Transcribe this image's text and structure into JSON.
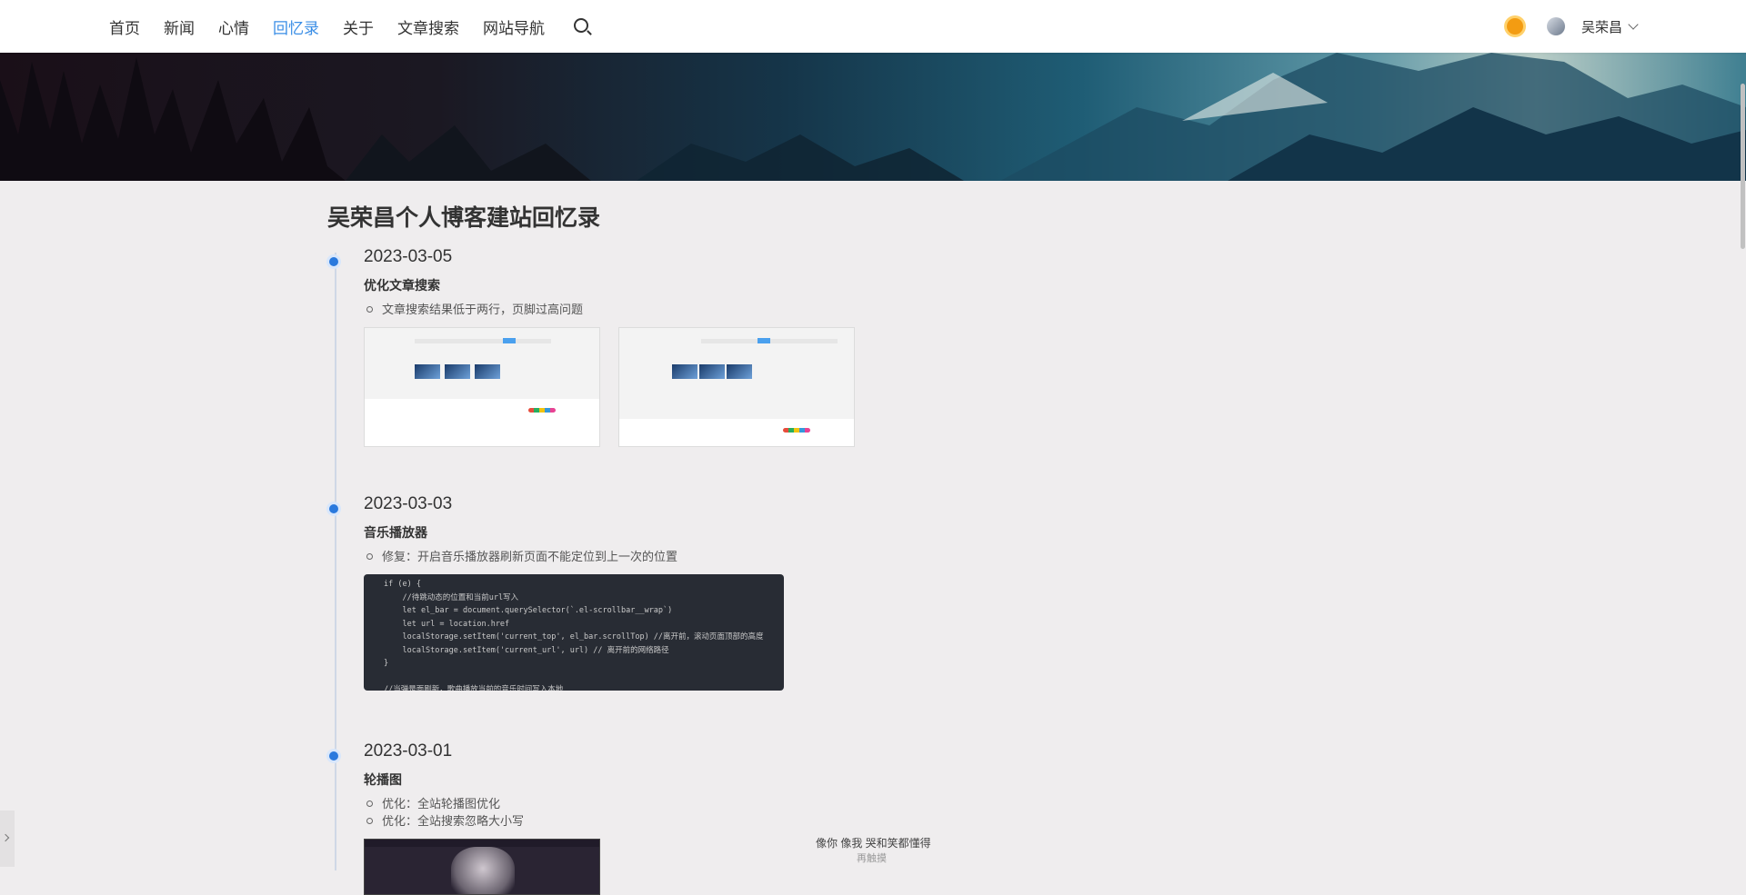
{
  "nav": {
    "items": [
      {
        "label": "首页"
      },
      {
        "label": "新闻"
      },
      {
        "label": "心情"
      },
      {
        "label": "回忆录"
      },
      {
        "label": "关于"
      },
      {
        "label": "文章搜索"
      },
      {
        "label": "网站导航"
      }
    ],
    "active": "回忆录",
    "user_name": "吴荣昌"
  },
  "page": {
    "title": "吴荣昌个人博客建站回忆录"
  },
  "timeline": [
    {
      "date": "2023-03-05",
      "title": "优化文章搜索",
      "items": [
        "文章搜索结果低于两行，页脚过高问题"
      ]
    },
    {
      "date": "2023-03-03",
      "title": "音乐播放器",
      "items": [
        "修复：开启音乐播放器刷新页面不能定位到上一次的位置"
      ]
    },
    {
      "date": "2023-03-01",
      "title": "轮播图",
      "items": [
        "优化：全站轮播图优化",
        "优化：全站搜索忽略大小写"
      ]
    }
  ],
  "code": {
    "lines": [
      "if (e) {",
      "    //待跳动态的位置和当前url写入",
      "    let el_bar = document.querySelector(`.el-scrollbar__wrap`)",
      "    let url = location.href",
      "    localStorage.setItem('current_top', el_bar.scrollTop) //离开前，滚动页面顶部的高度",
      "    localStorage.setItem('current_url', url) // 离开前的网络路径",
      "}",
      "",
      "//当弹是面刷新，歌曲播放当前的音乐时间写入本地"
    ]
  },
  "music": {
    "lyric": "像你 像我 哭和笑都懂得",
    "next_lyric": "再触摸"
  },
  "colors": {
    "accent": "#3a8ee6",
    "dot": "#2a79dd",
    "background": "#efedee"
  }
}
